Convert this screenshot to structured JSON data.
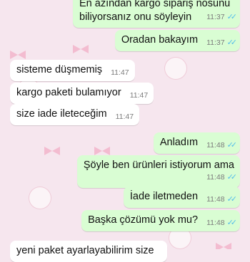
{
  "colors": {
    "outgoing_bubble": "#d9fdd3",
    "incoming_bubble": "#ffffff",
    "wallpaper": "#f6e6ee",
    "read_ticks": "#53bdeb"
  },
  "messages": [
    {
      "direction": "outgoing",
      "lines": [
        "En azından kargo sipariş nosunu",
        "biliyorsanız onu söyleyin"
      ],
      "time": "11:37",
      "status": "read"
    },
    {
      "direction": "outgoing",
      "text": "Oradan bakayım",
      "time": "11:37",
      "status": "read"
    },
    {
      "direction": "incoming",
      "text": "sisteme düşmemiş",
      "time": "11:47"
    },
    {
      "direction": "incoming",
      "text": "kargo paketi bulamıyor",
      "time": "11:47"
    },
    {
      "direction": "incoming",
      "text": "size iade ileteceğim",
      "time": "11:47"
    },
    {
      "direction": "outgoing",
      "text": "Anladım",
      "time": "11:48",
      "status": "read"
    },
    {
      "direction": "outgoing",
      "text": "Şöyle ben ürünleri istiyorum ama",
      "time": "11:48",
      "status": "read"
    },
    {
      "direction": "outgoing",
      "text": "İade iletmeden",
      "time": "11:48",
      "status": "read"
    },
    {
      "direction": "outgoing",
      "text": "Başka çözümü yok mu?",
      "time": "11:48",
      "status": "read"
    },
    {
      "direction": "incoming",
      "text": "yeni paket ayarlayabilirim size",
      "time": ""
    }
  ]
}
